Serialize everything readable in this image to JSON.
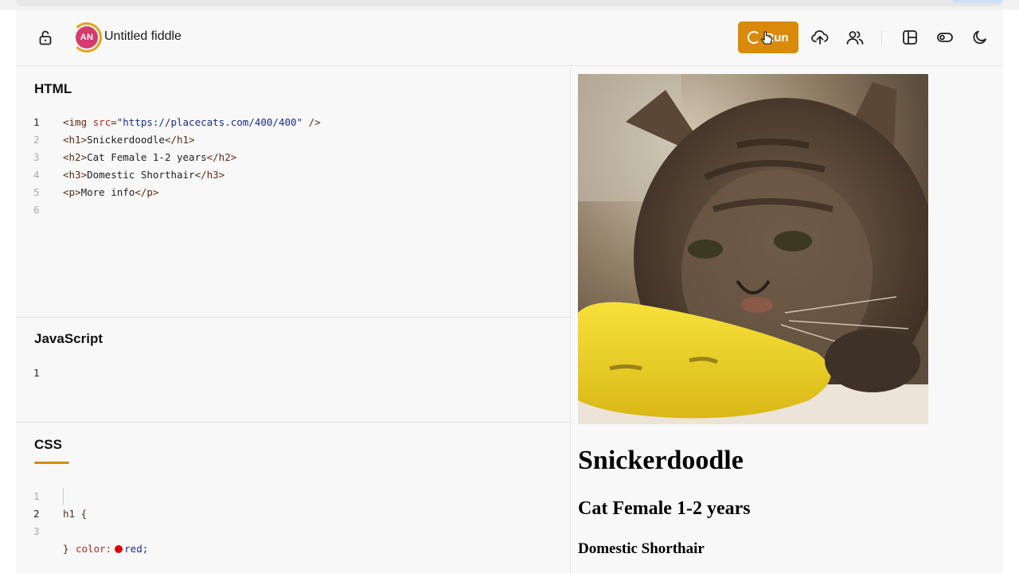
{
  "header": {
    "avatar_initials": "AN",
    "fiddle_title": "Untitled fiddle",
    "run_label": "Run",
    "accent_color": "#d98a0a",
    "avatar_color": "#d63b6f",
    "icons": [
      "lock-icon",
      "upload-icon",
      "users-icon",
      "layout-icon",
      "toggle-icon",
      "moon-icon"
    ]
  },
  "html_panel": {
    "title": "HTML",
    "lines": [
      {
        "n": "1",
        "parts": [
          [
            "tag",
            "<img "
          ],
          [
            "attr",
            "src"
          ],
          [
            "tag",
            "="
          ],
          [
            "str",
            "\"https://placecats.com/400/400\""
          ],
          [
            "tag",
            " />"
          ]
        ]
      },
      {
        "n": "2",
        "parts": [
          [
            "tag",
            "<h1>"
          ],
          [
            "txt",
            "Snickerdoodle"
          ],
          [
            "tag",
            "</h1>"
          ]
        ]
      },
      {
        "n": "3",
        "parts": [
          [
            "tag",
            "<h2>"
          ],
          [
            "txt",
            "Cat Female 1-2 years"
          ],
          [
            "tag",
            "</h2>"
          ]
        ]
      },
      {
        "n": "4",
        "parts": [
          [
            "tag",
            "<h3>"
          ],
          [
            "txt",
            "Domestic Shorthair"
          ],
          [
            "tag",
            "</h3>"
          ]
        ]
      },
      {
        "n": "5",
        "parts": [
          [
            "tag",
            "<p>"
          ],
          [
            "txt",
            "More info"
          ],
          [
            "tag",
            "</p>"
          ]
        ]
      },
      {
        "n": "6",
        "parts": []
      }
    ]
  },
  "js_panel": {
    "title": "JavaScript",
    "lines": [
      {
        "n": "1",
        "parts": []
      }
    ]
  },
  "css_panel": {
    "title": "CSS",
    "line1_num": "1",
    "line1_selector": "h1 {",
    "line2_num": "2",
    "line2_prop": "color:",
    "line2_value": "red;",
    "swatch_color": "#e00000",
    "line3_num": "3",
    "line3_text": "}"
  },
  "preview": {
    "h1": "Snickerdoodle",
    "h2": "Cat Female 1-2 years",
    "h3": "Domestic Shorthair"
  }
}
